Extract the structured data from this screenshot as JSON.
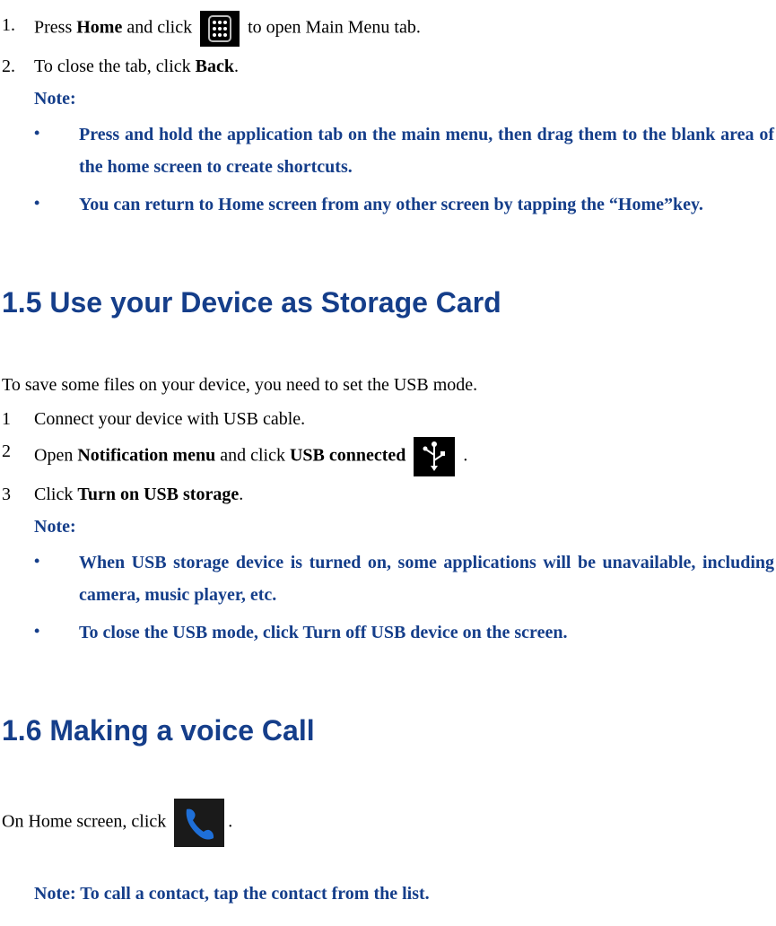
{
  "section1": {
    "item1_num": "1.",
    "item1_pre": "Press ",
    "item1_bold1": "Home",
    "item1_mid": " and click ",
    "item1_post": " to open Main Menu tab.",
    "item2_num": "2.",
    "item2_pre": "To close the tab, click ",
    "item2_bold": "Back",
    "item2_post": ".",
    "note_label": "Note:",
    "note_b1": "Press and hold the application tab on the main menu, then drag them to the blank area of the home screen to create shortcuts.",
    "note_b2": "You can return to Home screen from any other screen by tapping the “Home”key."
  },
  "sec15": {
    "heading": "1.5 Use your Device as Storage Card",
    "intro": "To save some files on your device, you need to set the USB mode.",
    "i1_num": "1",
    "i1_txt": "Connect your device with USB cable.",
    "i2_num": "2",
    "i2_pre": "Open ",
    "i2_b1": "Notification menu",
    "i2_mid": " and click ",
    "i2_b2": "USB connected",
    "i2_post": " .",
    "i3_num": "3",
    "i3_pre": "Click ",
    "i3_b1": "Turn on USB storage",
    "i3_post": ".",
    "note_label": "Note:",
    "note_b1": "When USB storage device is turned on, some applications will be unavailable, including camera, music player, etc.",
    "note_b2": "To close the USB mode, click Turn off USB device on the screen."
  },
  "sec16": {
    "heading": "1.6 Making a voice Call",
    "line_pre": "On Home screen, click ",
    "line_post": ".",
    "note": "Note: To call a contact, tap the contact from the list."
  },
  "bullets": {
    "dot": "•"
  }
}
